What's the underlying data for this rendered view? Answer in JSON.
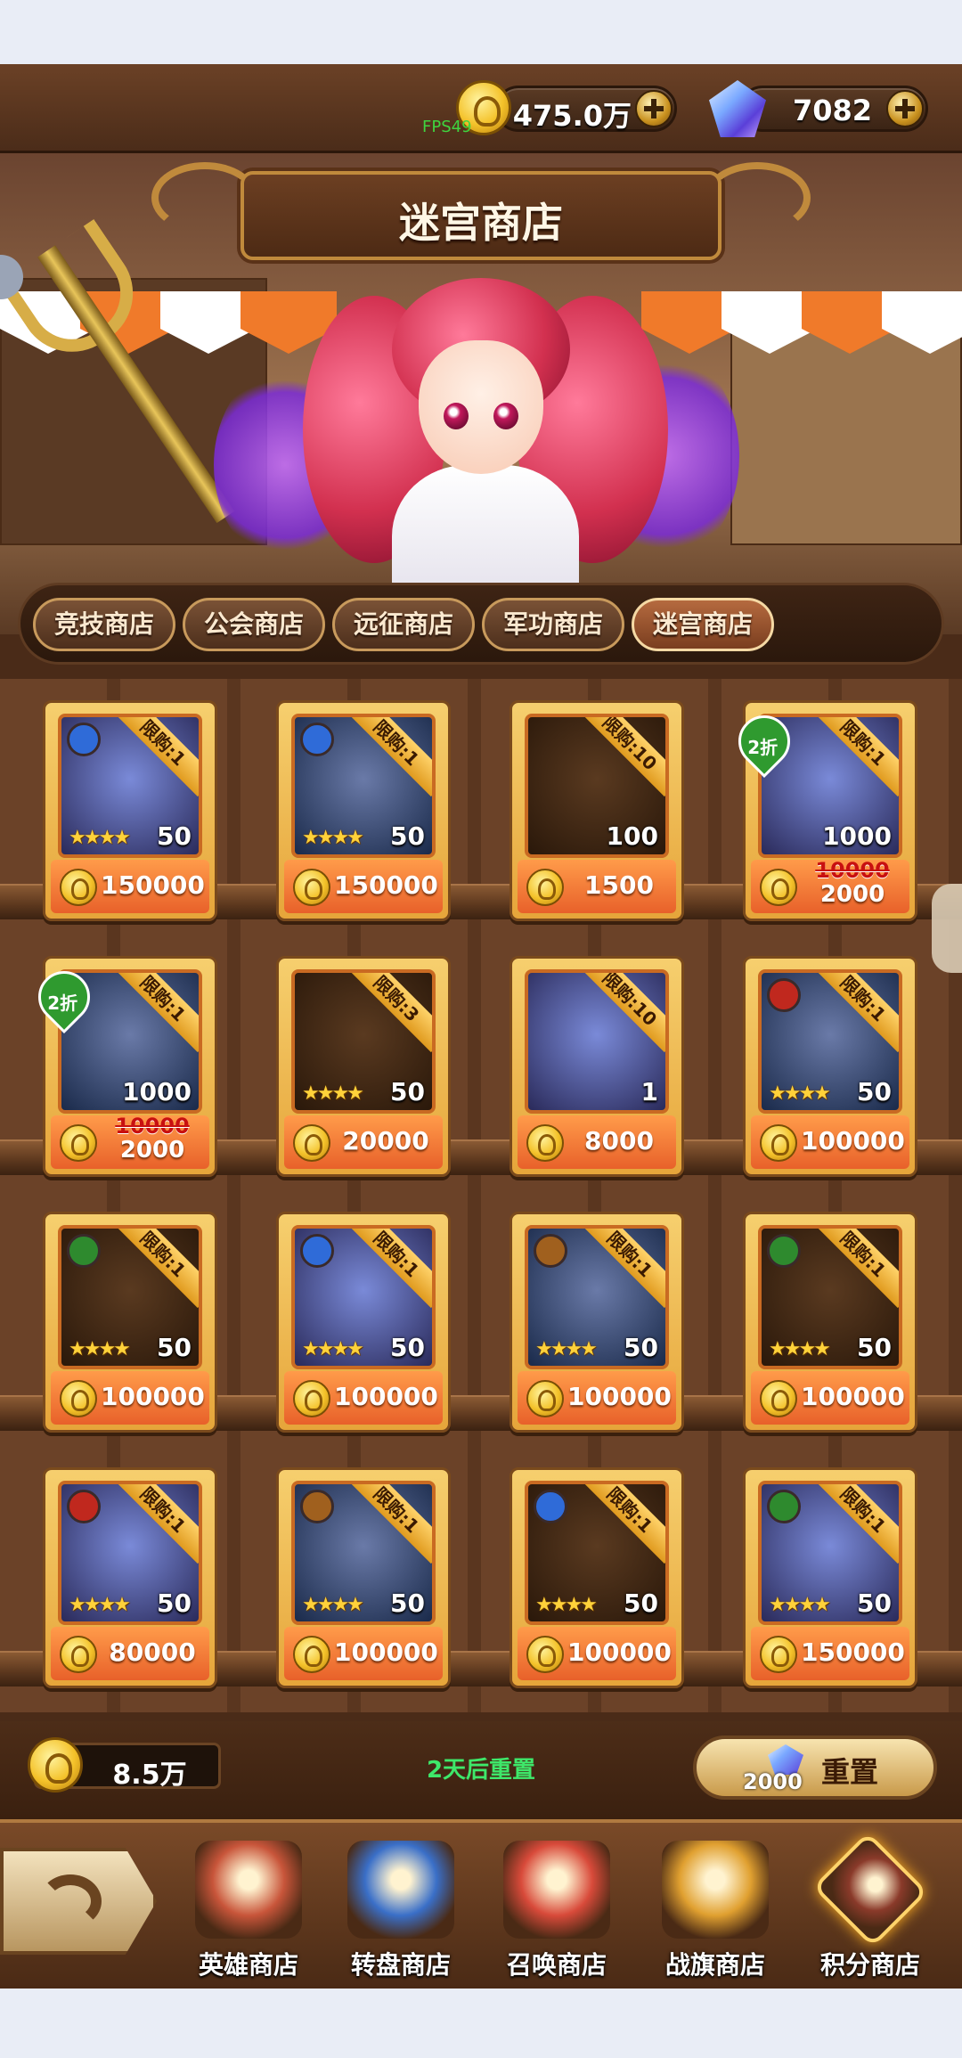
{
  "currency": {
    "gold": "475.0万",
    "gems": "7082",
    "fps": "FPS49"
  },
  "title": "迷宫商店",
  "tabs": [
    {
      "label": "竞技商店",
      "active": false
    },
    {
      "label": "公会商店",
      "active": false
    },
    {
      "label": "远征商店",
      "active": false
    },
    {
      "label": "军功商店",
      "active": false
    },
    {
      "label": "迷宫商店",
      "active": true
    }
  ],
  "items": [
    {
      "name": "hero-blue-knight-girl",
      "limit": "限购:1",
      "count": "50",
      "stars": "★★★★",
      "price": "150000",
      "faction": "#2f6bd8"
    },
    {
      "name": "hero-armored-knight",
      "limit": "限购:1",
      "count": "50",
      "stars": "★★★★",
      "price": "150000",
      "faction": "#2f6bd8"
    },
    {
      "name": "summon-scroll",
      "limit": "限购:10",
      "count": "100",
      "price": "1500"
    },
    {
      "name": "blue-crest",
      "limit": "限购:1",
      "count": "1000",
      "discount": "2折",
      "old_price": "10000",
      "price": "2000"
    },
    {
      "name": "green-crystal",
      "limit": "限购:1",
      "count": "1000",
      "discount": "2折",
      "old_price": "10000",
      "price": "2000"
    },
    {
      "name": "shadow-hero",
      "limit": "限购:3",
      "count": "50",
      "stars": "★★★★",
      "price": "20000"
    },
    {
      "name": "gold-gem",
      "limit": "限购:10",
      "count": "1",
      "price": "8000"
    },
    {
      "name": "hero-dark-girl",
      "limit": "限购:1",
      "count": "50",
      "stars": "★★★★",
      "price": "100000",
      "faction": "#c0281e"
    },
    {
      "name": "hero-elf-girl",
      "limit": "限购:1",
      "count": "50",
      "stars": "★★★★",
      "price": "100000",
      "faction": "#2e8a2e"
    },
    {
      "name": "hero-blue-mech",
      "limit": "限购:1",
      "count": "50",
      "stars": "★★★★",
      "price": "100000",
      "faction": "#2f6bd8"
    },
    {
      "name": "hero-wolf",
      "limit": "限购:1",
      "count": "50",
      "stars": "★★★★",
      "price": "100000",
      "faction": "#a0601e"
    },
    {
      "name": "hero-cyan-girl",
      "limit": "限购:1",
      "count": "50",
      "stars": "★★★★",
      "price": "100000",
      "faction": "#2e8a2e"
    },
    {
      "name": "hero-demon-warrior",
      "limit": "限购:1",
      "count": "50",
      "stars": "★★★★",
      "price": "80000",
      "faction": "#c0281e"
    },
    {
      "name": "hero-white-lady",
      "limit": "限购:1",
      "count": "50",
      "stars": "★★★★",
      "price": "100000",
      "faction": "#a0601e"
    },
    {
      "name": "hero-sos-robot",
      "limit": "限购:1",
      "count": "50",
      "stars": "★★★★",
      "price": "100000",
      "faction": "#2f6bd8"
    },
    {
      "name": "hero-green-girl",
      "limit": "限购:1",
      "count": "50",
      "stars": "★★★★",
      "price": "150000",
      "faction": "#2e8a2e"
    }
  ],
  "footer": {
    "balance": "8.5万",
    "reset_note": "2天后重置",
    "reset_label": "重置",
    "reset_cost": "2000"
  },
  "nav": [
    {
      "label": "英雄商店",
      "icon": "hero-shop-icon",
      "color": "#c8553a",
      "active": false
    },
    {
      "label": "转盘商店",
      "icon": "wheel-shop-icon",
      "color": "#3a6fc8",
      "active": false
    },
    {
      "label": "召唤商店",
      "icon": "summon-shop-icon",
      "color": "#d84a3a",
      "active": false
    },
    {
      "label": "战旗商店",
      "icon": "banner-shop-icon",
      "color": "#e0a030",
      "active": false
    },
    {
      "label": "积分商店",
      "icon": "points-shop-icon",
      "color": "#8a3a2a",
      "active": true
    }
  ]
}
